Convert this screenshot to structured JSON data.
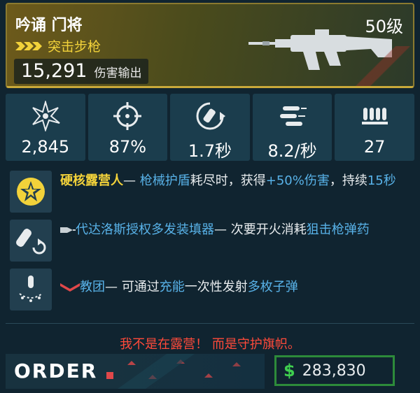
{
  "weapon": {
    "name": "吟诵 门将",
    "level": "50级",
    "type": "突击步枪",
    "damage_value": "15,291",
    "damage_label": "伤害输出"
  },
  "stats": [
    {
      "icon": "impact-icon",
      "value": "2,845"
    },
    {
      "icon": "crosshair-icon",
      "value": "87%"
    },
    {
      "icon": "reload-icon",
      "value": "1.7秒"
    },
    {
      "icon": "bullets-icon",
      "value": "8.2/秒"
    },
    {
      "icon": "magazine-icon",
      "value": "27"
    }
  ],
  "perks": [
    {
      "icon": "star-badge-icon",
      "title": "硬核露营人",
      "dash": "— ",
      "p1": "枪械护盾",
      "p2": "耗尽时，获得",
      "p3": "+50%伤害",
      "p4": "，持续",
      "p5": "15秒"
    },
    {
      "icon": "ammo-refill-icon",
      "prefix_icon": "manufacturer-icon",
      "title": "代达洛斯授权多发装填器",
      "dash": "— ",
      "p1": "次要开火消耗",
      "p2": "狙击枪弹药"
    },
    {
      "icon": "charge-shot-icon",
      "prefix_icon": "order-chevron-icon",
      "title": "教团",
      "dash": "— ",
      "p1": "可通过",
      "p2": "充能",
      "p3": "一次性发射",
      "p4": "多枚子弹"
    }
  ],
  "flavor_text": "我不是在露营！ 而是守护旗帜。",
  "manufacturer": "ORDER",
  "price": {
    "icon": "$",
    "value": "283,830"
  },
  "colors": {
    "rarity_gold": "#f2d23a",
    "highlight_blue": "#58b2e8",
    "flavor_red": "#ff4a3a",
    "price_green": "#2d8b3a"
  }
}
